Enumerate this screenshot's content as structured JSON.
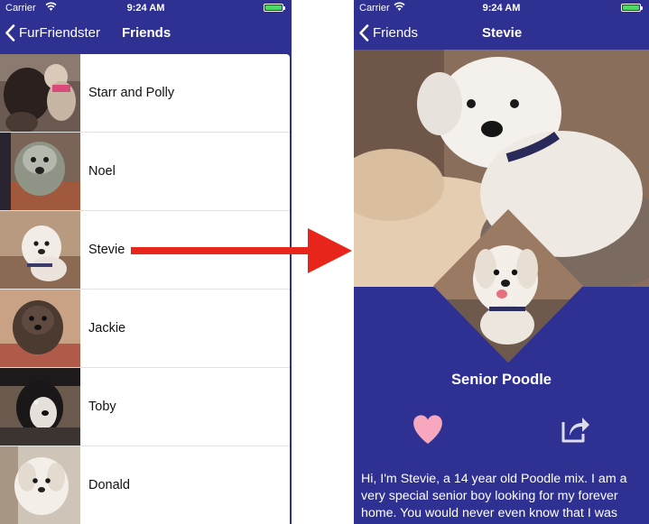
{
  "status_bar": {
    "carrier": "Carrier",
    "time": "9:24 AM"
  },
  "list_screen": {
    "back_label": "FurFriendster",
    "title": "Friends",
    "friends": [
      {
        "name": "Starr and Polly"
      },
      {
        "name": "Noel"
      },
      {
        "name": "Stevie"
      },
      {
        "name": "Jackie"
      },
      {
        "name": "Toby"
      },
      {
        "name": "Donald"
      }
    ]
  },
  "detail_screen": {
    "back_label": "Friends",
    "title": "Stevie",
    "breed": "Senior Poodle",
    "bio_lines": [
      "Hi, I'm Stevie, a 14 year old Poodle mix. I am a",
      "very special senior boy looking for my forever",
      "home. You would never even know that I was"
    ]
  },
  "colors": {
    "nav_bar": "#2e3192",
    "detail_background": "#2e3192",
    "heart": "#f7a8be",
    "arrow": "#e8251a",
    "battery": "#4cd964"
  },
  "icons": {
    "back": "chevron-left-icon",
    "heart": "heart-icon",
    "share": "share-icon",
    "arrow": "right-arrow-icon"
  }
}
